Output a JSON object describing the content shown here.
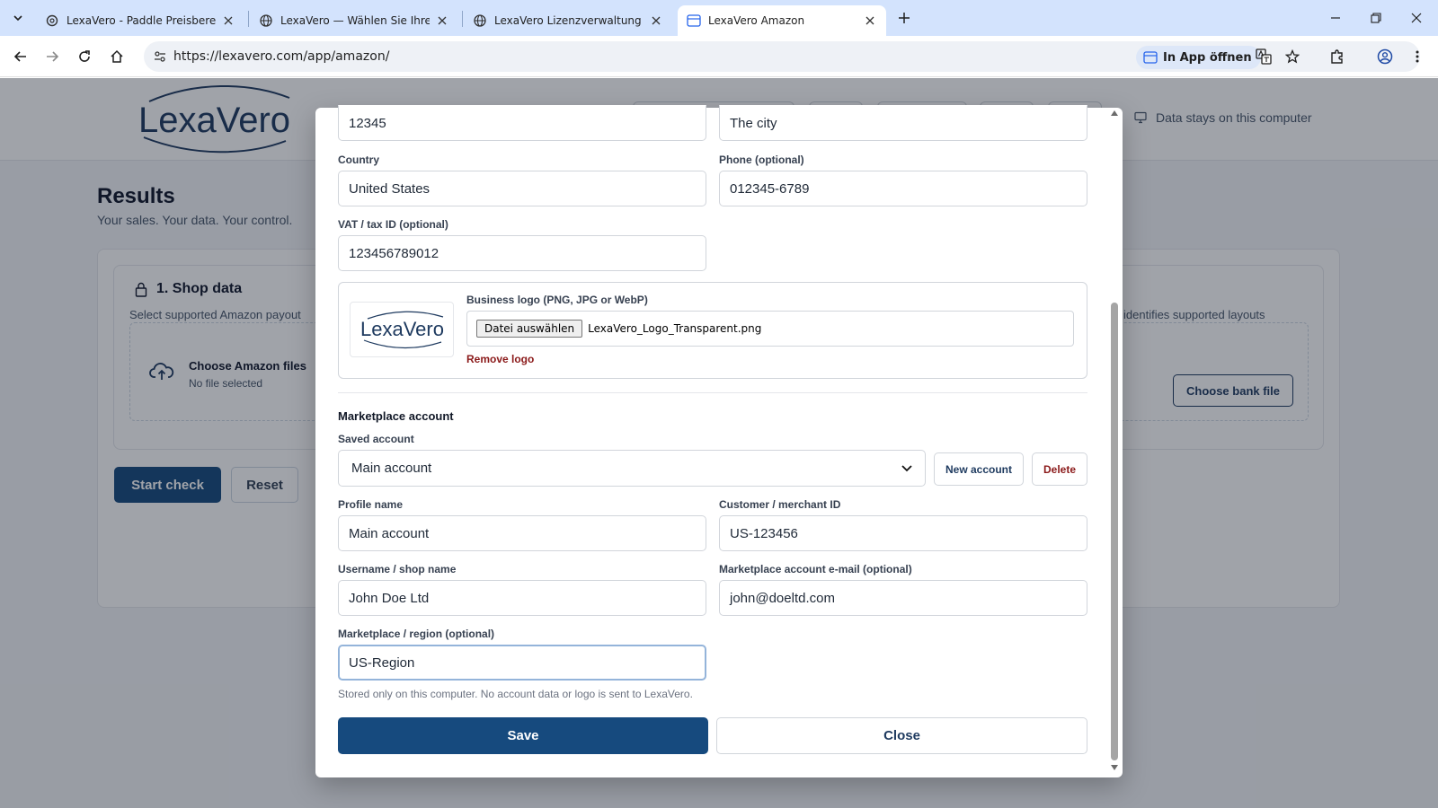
{
  "browser": {
    "tabs": [
      {
        "title": "LexaVero - Paddle Preisberechnung",
        "active": false
      },
      {
        "title": "LexaVero — Wählen Sie Ihre LexaVero",
        "active": false
      },
      {
        "title": "LexaVero Lizenzverwaltung",
        "active": false
      },
      {
        "title": "LexaVero Amazon",
        "active": true
      }
    ],
    "url": "https://lexavero.com/app/amazon/",
    "open_in_app": "In App öffnen"
  },
  "site": {
    "logo_text": "LexaVero",
    "privacy_note": "Data stays on this computer"
  },
  "results": {
    "title": "Results",
    "subtitle": "Your sales. Your data. Your control.",
    "shop_title": "1. Shop data",
    "shop_desc": "Select supported Amazon payout",
    "shop_desc_right": "identifies supported layouts",
    "drop_title": "Choose Amazon files",
    "drop_sub": "No file selected",
    "bank_button": "Choose bank file",
    "start_button": "Start check",
    "reset_button": "Reset"
  },
  "modal": {
    "zip": "12345",
    "city": "The city",
    "country_label": "Country",
    "country": "United States",
    "phone_label": "Phone (optional)",
    "phone": "012345-6789",
    "vat_label": "VAT / tax ID (optional)",
    "vat": "123456789012",
    "logo_label": "Business logo (PNG, JPG or WebP)",
    "choose_file": "Datei auswählen",
    "file_name": "LexaVero_Logo_Transparent.png",
    "remove_logo": "Remove logo",
    "logo_text": "LexaVero",
    "marketplace_title": "Marketplace account",
    "saved_account_label": "Saved account",
    "saved_account": "Main account",
    "new_account": "New account",
    "delete": "Delete",
    "profile_label": "Profile name",
    "profile": "Main account",
    "merchant_label": "Customer / merchant ID",
    "merchant": "US-123456",
    "username_label": "Username / shop name",
    "username": "John Doe Ltd",
    "email_label": "Marketplace account e-mail (optional)",
    "email": "john@doeltd.com",
    "region_label": "Marketplace / region (optional)",
    "region": "US-Region",
    "note": "Stored only on this computer. No account data or logo is sent to LexaVero.",
    "save": "Save",
    "close": "Close"
  },
  "colors": {
    "primary": "#164a7e",
    "danger": "#8b1a1a",
    "tabstrip": "#d3e3fd"
  }
}
